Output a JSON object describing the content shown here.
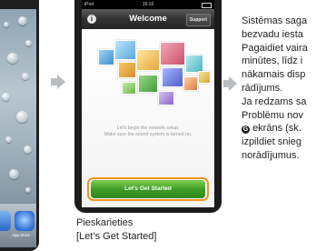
{
  "left_phone": {
    "dock_label": "App Store"
  },
  "phone": {
    "status": {
      "carrier": "iPod",
      "time": "15:16"
    },
    "nav": {
      "info_glyph": "i",
      "title": "Welcome",
      "support_label": "Support"
    },
    "message_lines": [
      "Let's begin the network setup.",
      "Make sure the sound system is turned on."
    ],
    "start_button_label": "Let's Get Started"
  },
  "caption_lines": [
    "Pieskarieties",
    "[Let’s Get Started]"
  ],
  "instructions": {
    "lines": [
      "Sistēmas saga",
      "bezvadu iesta",
      "Pagaidiet vaira",
      "minūtes, līdz i",
      "nākamais disp",
      "rādījums.",
      "Ja redzams sa",
      "Problēmu nov",
      "ekrāns (sk.",
      "izpildiet snieg",
      "norādījumus."
    ],
    "marker_glyph": "G"
  },
  "colors": {
    "accent_orange": "#f2931f",
    "button_green": "#3c9a26",
    "arrow_gray": "#b9bdc0"
  }
}
